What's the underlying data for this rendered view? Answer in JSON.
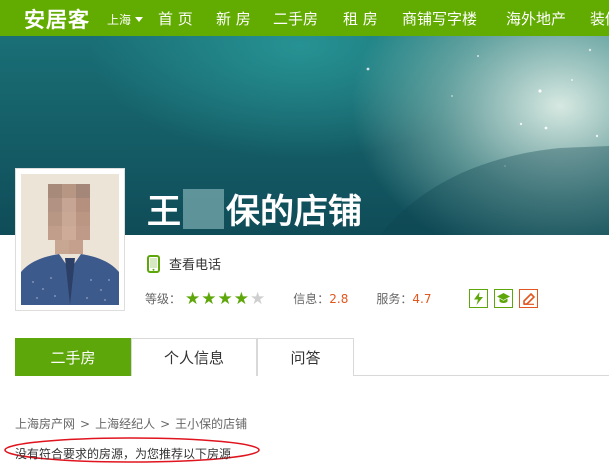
{
  "header": {
    "logo": "安居客",
    "city": "上海",
    "nav": [
      "首 页",
      "新 房",
      "二手房",
      "租 房",
      "商铺写字楼",
      "海外地产",
      "装修"
    ]
  },
  "shop": {
    "name_first": "王",
    "name_rest": "保的店铺"
  },
  "contact": {
    "phone_label": "查看电话"
  },
  "rating": {
    "level_label": "等级：",
    "stars_filled": 4,
    "stars_total": 5,
    "info_label": "信息：",
    "info_value": "2.8",
    "service_label": "服务：",
    "service_value": "4.7",
    "badges": [
      "lightning-icon",
      "graduation-cap-icon",
      "pen-icon"
    ]
  },
  "tabs": [
    {
      "label": "二手房",
      "active": true
    },
    {
      "label": "个人信息",
      "active": false
    },
    {
      "label": "问答",
      "active": false
    }
  ],
  "breadcrumb": [
    "上海房产网",
    "上海经纪人",
    "王小保的店铺"
  ],
  "message": "没有符合要求的房源，为您推荐以下房源",
  "colors": {
    "brand_green": "#62ab00",
    "tab_active": "#5ea70b",
    "value_orange": "#e2561f",
    "annotation_red": "#e0141e"
  }
}
